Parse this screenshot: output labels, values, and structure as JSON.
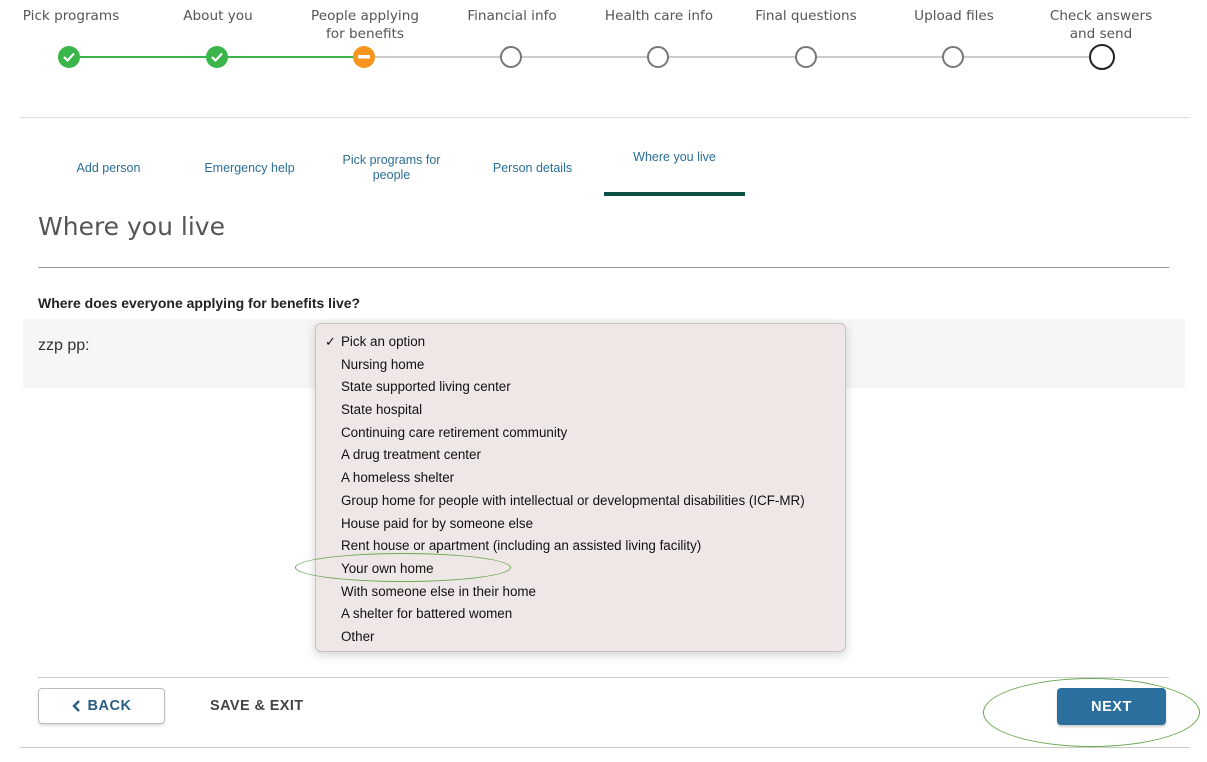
{
  "stepper": {
    "steps": [
      {
        "label": "Pick programs",
        "status": "done"
      },
      {
        "label": "About you",
        "status": "done"
      },
      {
        "label": "People applying\nfor benefits",
        "status": "current"
      },
      {
        "label": "Financial info",
        "status": "todo"
      },
      {
        "label": "Health care info",
        "status": "todo"
      },
      {
        "label": "Final questions",
        "status": "todo"
      },
      {
        "label": "Upload files",
        "status": "todo"
      },
      {
        "label": "Check answers\nand send",
        "status": "todo"
      }
    ],
    "colors": {
      "done": "#39b54a",
      "current": "#f7941d"
    }
  },
  "subtabs": [
    {
      "label": "Add person"
    },
    {
      "label": "Emergency help"
    },
    {
      "label": "Pick programs for people"
    },
    {
      "label": "Person details"
    },
    {
      "label": "Where you live",
      "active": true
    }
  ],
  "page": {
    "title": "Where you live",
    "question": "Where does everyone applying for benefits live?",
    "person_label": "zzp pp:"
  },
  "dropdown": {
    "selected": "Pick an option",
    "options": [
      "Pick an option",
      "Nursing home",
      "State supported living center",
      "State hospital",
      "Continuing care retirement community",
      "A drug treatment center",
      "A homeless shelter",
      "Group home for people with intellectual or developmental disabilities (ICF-MR)",
      "House paid for by someone else",
      "Rent house or apartment (including an assisted living facility)",
      "Your own home",
      "With someone else in their home",
      "A shelter for battered women",
      "Other"
    ],
    "check_glyph": "✓"
  },
  "footer": {
    "back_label": "BACK",
    "save_exit_label": "SAVE & EXIT",
    "next_label": "NEXT"
  },
  "colors": {
    "accent": "#2b6f9e",
    "active_tab_underline": "#0b4f45",
    "annotation": "#6aa84f"
  }
}
